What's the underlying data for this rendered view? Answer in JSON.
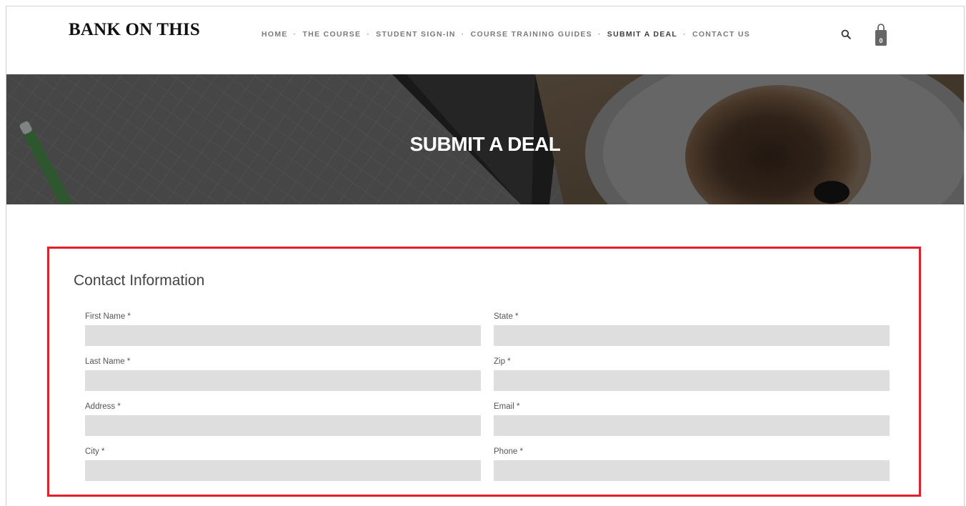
{
  "header": {
    "logo": "BANK ON THIS",
    "nav": [
      {
        "label": "HOME",
        "active": false
      },
      {
        "label": "THE COURSE",
        "active": false
      },
      {
        "label": "STUDENT SIGN-IN",
        "active": false
      },
      {
        "label": "COURSE TRAINING GUIDES",
        "active": false
      },
      {
        "label": "SUBMIT A DEAL",
        "active": true
      },
      {
        "label": "CONTACT US",
        "active": false
      }
    ],
    "separator": "·",
    "search_icon": "search-icon",
    "cart_icon": "shopping-bag-icon",
    "cart_count": "0"
  },
  "hero": {
    "title": "SUBMIT A DEAL"
  },
  "form": {
    "section_title": "Contact Information",
    "fields": [
      {
        "label": "First Name *",
        "value": ""
      },
      {
        "label": "Last Name *",
        "value": ""
      },
      {
        "label": "Address *",
        "value": ""
      },
      {
        "label": "City *",
        "value": ""
      },
      {
        "label": "State *",
        "value": ""
      },
      {
        "label": "Zip *",
        "value": ""
      },
      {
        "label": "Email *",
        "value": ""
      },
      {
        "label": "Phone *",
        "value": ""
      }
    ],
    "highlight_color": "#e0202a"
  },
  "colors": {
    "input_bg": "#dedede",
    "nav_text": "#7a7a7a",
    "nav_active": "#3d3d3d"
  }
}
